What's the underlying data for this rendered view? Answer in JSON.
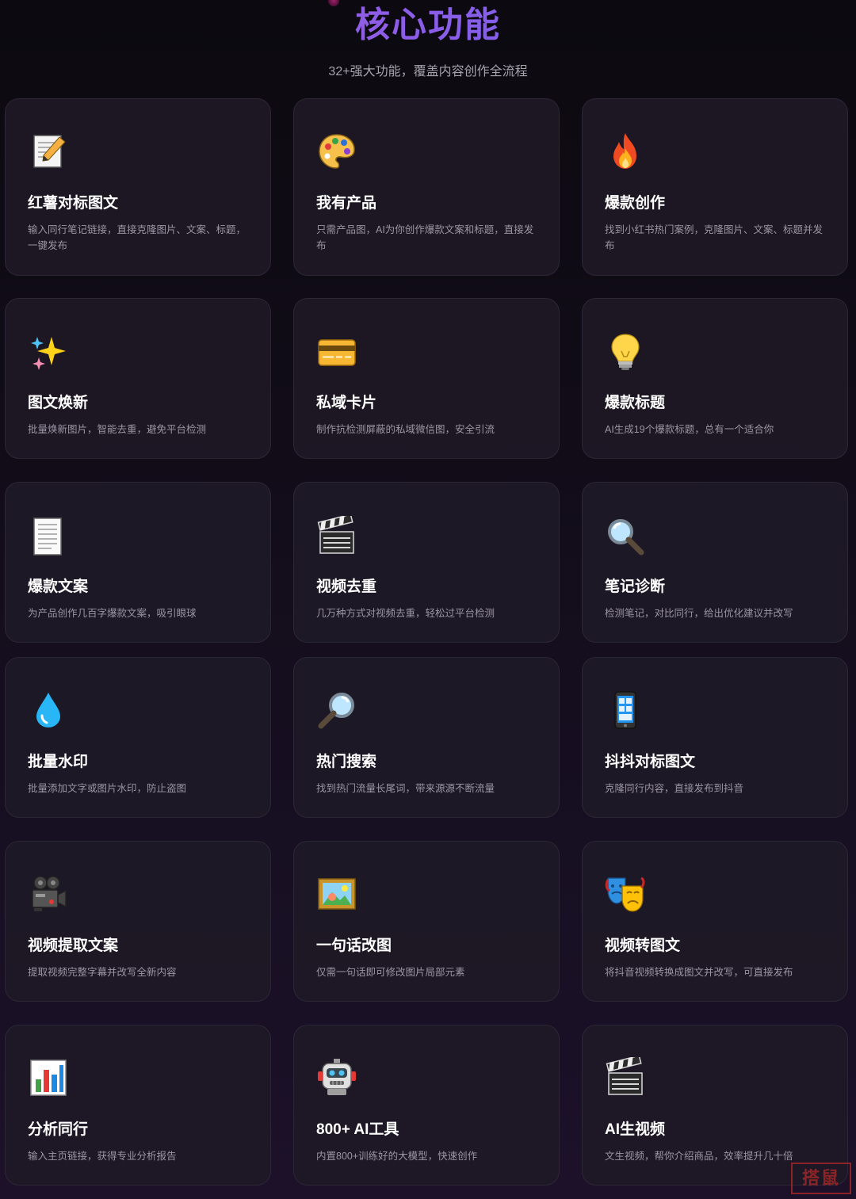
{
  "header": {
    "title": "核心功能",
    "subtitle": "32+强大功能，覆盖内容创作全流程"
  },
  "features": [
    {
      "icon": "memo-icon",
      "name": "红薯对标图文",
      "desc": "输入同行笔记链接，直接克隆图片、文案、标题，一键发布"
    },
    {
      "icon": "palette-icon",
      "name": "我有产品",
      "desc": "只需产品图，AI为你创作爆款文案和标题，直接发布"
    },
    {
      "icon": "fire-icon",
      "name": "爆款创作",
      "desc": "找到小红书热门案例，克隆图片、文案、标题并发布"
    },
    {
      "icon": "sparkles-icon",
      "name": "图文焕新",
      "desc": "批量焕新图片，智能去重，避免平台检测"
    },
    {
      "icon": "credit-card-icon",
      "name": "私域卡片",
      "desc": "制作抗检测屏蔽的私域微信图，安全引流"
    },
    {
      "icon": "light-bulb-icon",
      "name": "爆款标题",
      "desc": "AI生成19个爆款标题，总有一个适合你"
    },
    {
      "icon": "document-icon",
      "name": "爆款文案",
      "desc": "为产品创作几百字爆款文案，吸引眼球"
    },
    {
      "icon": "clapper-board-icon",
      "name": "视频去重",
      "desc": "几万种方式对视频去重，轻松过平台检测"
    },
    {
      "icon": "magnifier-icon",
      "name": "笔记诊断",
      "desc": "检测笔记，对比同行，给出优化建议并改写"
    },
    {
      "icon": "droplet-icon",
      "name": "批量水印",
      "desc": "批量添加文字或图片水印，防止盗图"
    },
    {
      "icon": "magnifier-right-icon",
      "name": "热门搜索",
      "desc": "找到热门流量长尾词，带来源源不断流量"
    },
    {
      "icon": "mobile-phone-icon",
      "name": "抖抖对标图文",
      "desc": "克隆同行内容，直接发布到抖音"
    },
    {
      "icon": "movie-camera-icon",
      "name": "视频提取文案",
      "desc": "提取视频完整字幕并改写全新内容"
    },
    {
      "icon": "framed-picture-icon",
      "name": "一句话改图",
      "desc": "仅需一句话即可修改图片局部元素"
    },
    {
      "icon": "theater-masks-icon",
      "name": "视频转图文",
      "desc": "将抖音视频转换成图文并改写，可直接发布"
    },
    {
      "icon": "bar-chart-icon",
      "name": "分析同行",
      "desc": "输入主页链接，获得专业分析报告"
    },
    {
      "icon": "robot-icon",
      "name": "800+ AI工具",
      "desc": "内置800+训练好的大模型，快速创作"
    },
    {
      "icon": "clapper-board-icon",
      "name": "AI生视频",
      "desc": "文生视频，帮你介绍商品，效率提升几十倍"
    }
  ],
  "watermark": {
    "text": "搭鼠"
  }
}
